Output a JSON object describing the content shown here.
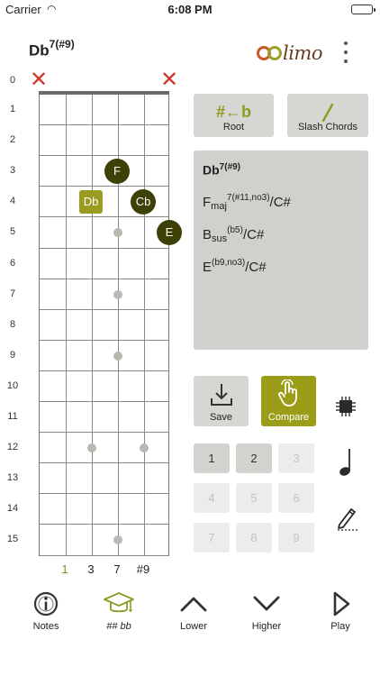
{
  "status": {
    "carrier": "Carrier",
    "time": "6:08 PM"
  },
  "chord": {
    "name": "Db",
    "extension": "7(#9)"
  },
  "logo": {
    "text": "limo"
  },
  "frets": [
    "0",
    "1",
    "2",
    "3",
    "4",
    "5",
    "6",
    "7",
    "8",
    "9",
    "10",
    "11",
    "12",
    "13",
    "14",
    "15"
  ],
  "muted_strings": [
    "x",
    "x"
  ],
  "notes": [
    {
      "label": "F",
      "string": 3,
      "fret": 3
    },
    {
      "label": "Db",
      "string": 2,
      "fret": 4,
      "root": true
    },
    {
      "label": "Cb",
      "string": 4,
      "fret": 4
    },
    {
      "label": "E",
      "string": 5,
      "fret": 5
    }
  ],
  "intervals": [
    "1",
    "3",
    "7",
    "#9"
  ],
  "buttons": {
    "root": "Root",
    "slash": "Slash Chords",
    "save": "Save",
    "compare": "Compare"
  },
  "root_icon": "#←b",
  "chord_panel": {
    "main_name": "Db",
    "main_ext": "7(#9)",
    "alternatives": [
      {
        "root": "F",
        "sub": "maj",
        "sup": "7(#11,no3)",
        "bass": "/C#"
      },
      {
        "root": "B",
        "sub": "sus",
        "sup": "(b5)",
        "bass": "/C#"
      },
      {
        "root": "E",
        "sub": "",
        "sup": "(b9,no3)",
        "bass": "/C#"
      }
    ]
  },
  "numbers": [
    "1",
    "2",
    "3",
    "4",
    "5",
    "6",
    "7",
    "8",
    "9"
  ],
  "tabs": [
    {
      "label": "Notes",
      "icon": "info-icon"
    },
    {
      "label": "## bb",
      "icon": "graduation-cap-icon"
    },
    {
      "label": "Lower",
      "icon": "chevron-up-icon"
    },
    {
      "label": "Higher",
      "icon": "chevron-down-icon"
    },
    {
      "label": "Play",
      "icon": "play-icon"
    }
  ]
}
